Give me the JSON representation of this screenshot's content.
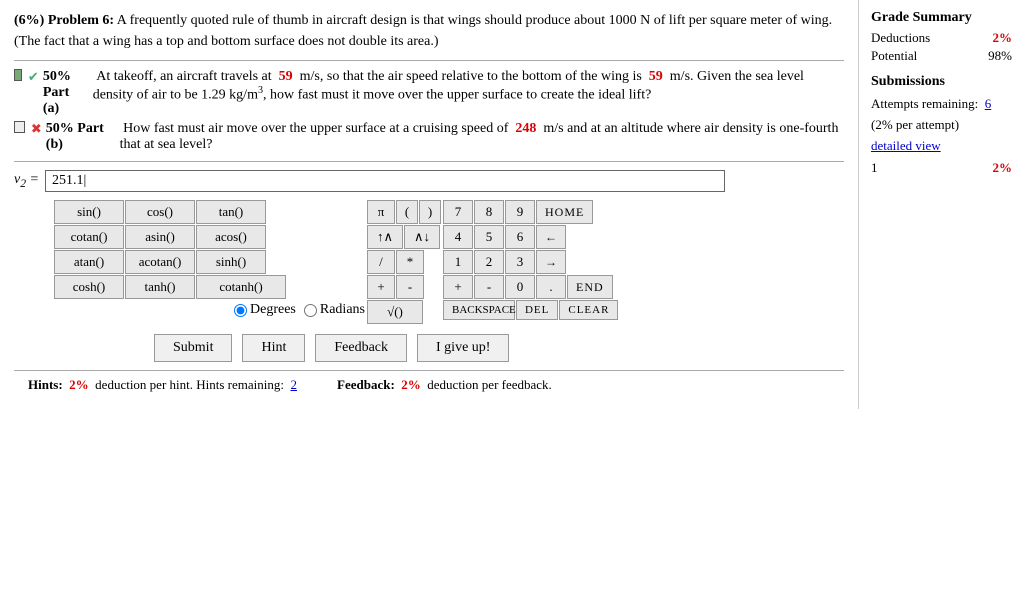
{
  "problem": {
    "header": "(6%) Problem 6:",
    "text": "A frequently quoted rule of thumb in aircraft design is that wings should produce about 1000 N of lift per square meter of wing. (The fact that a wing has a top and bottom surface does not double its area.)",
    "part_a": {
      "percent": "50% Part (a)",
      "text": "At takeoff, an aircraft travels at",
      "speed1": "59",
      "text2": "m/s, so that the air speed relative to the bottom of the wing is",
      "speed2": "59",
      "text3": "m/s. Given the sea level density of air to be 1.29 kg/m",
      "sup": "3",
      "text4": ", how fast must it move over the upper surface to create the ideal lift?"
    },
    "part_b": {
      "percent": "50% Part (b)",
      "text": "How fast must air move over the upper surface at a cruising speed of",
      "speed": "248",
      "text2": "m/s and at an altitude where air density is one-fourth that at sea level?"
    }
  },
  "input": {
    "label": "v₂ =",
    "value": "251.1|",
    "placeholder": ""
  },
  "calculator": {
    "trig_buttons": [
      [
        "sin()",
        "cos()",
        "tan()"
      ],
      [
        "cotan()",
        "asin()",
        "acos()"
      ],
      [
        "atan()",
        "acotan()",
        "sinh()"
      ],
      [
        "cosh()",
        "tanh()",
        "cotanh()"
      ]
    ],
    "special_buttons": [
      "π",
      "(",
      ")",
      "↑∧",
      "∧↓",
      "/",
      "*",
      "+",
      "-",
      "√()"
    ],
    "numpad": [
      [
        "7",
        "8",
        "9",
        "HOME"
      ],
      [
        "4",
        "5",
        "6",
        "←"
      ],
      [
        "1",
        "2",
        "3",
        "→"
      ],
      [
        "+",
        "-",
        "0",
        ".",
        "END"
      ],
      [
        "BACKSPACE",
        "DEL",
        "CLEAR"
      ]
    ],
    "degrees_label": "Degrees",
    "radians_label": "Radians"
  },
  "buttons": {
    "submit": "Submit",
    "hint": "Hint",
    "feedback": "Feedback",
    "give_up": "I give up!"
  },
  "hints": {
    "label": "Hints:",
    "deduction": "2%",
    "text": "deduction per hint. Hints remaining:",
    "remaining": "2"
  },
  "feedback_bottom": {
    "label": "Feedback:",
    "deduction": "2%",
    "text": "deduction per feedback."
  },
  "grade_summary": {
    "title": "Grade Summary",
    "deductions_label": "Deductions",
    "deductions_value": "2%",
    "potential_label": "Potential",
    "potential_value": "98%"
  },
  "submissions": {
    "title": "Submissions",
    "attempts_label": "Attempts remaining:",
    "attempts_value": "6",
    "per_attempt": "(2% per attempt)",
    "detailed_view": "detailed view",
    "attempt_number": "1",
    "attempt_score": "2%"
  }
}
